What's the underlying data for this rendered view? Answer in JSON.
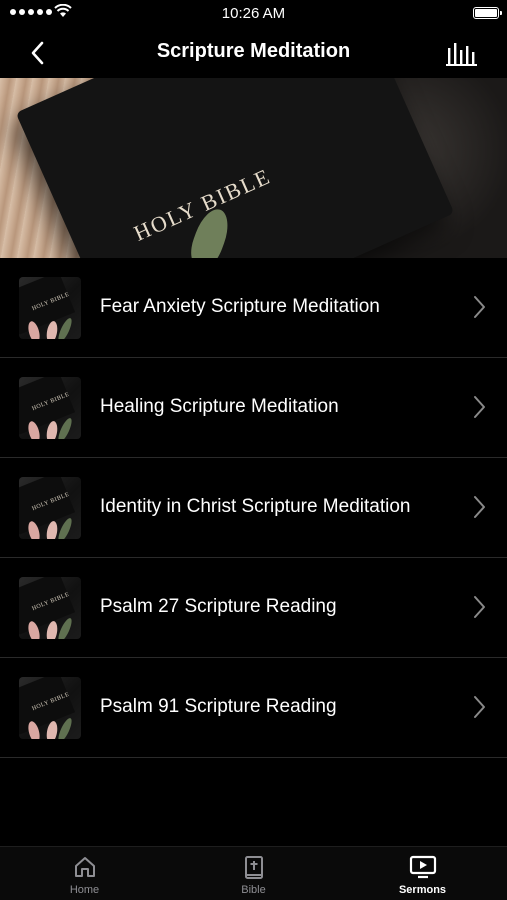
{
  "status_bar": {
    "time": "10:26 AM",
    "battery_level": 1.0
  },
  "nav": {
    "title": "Scripture Meditation",
    "back_icon": "chevron-left-icon",
    "right_icon": "audio-bars-icon"
  },
  "hero": {
    "book_text": "HOLY BIBLE"
  },
  "items": [
    {
      "title": "Fear Anxiety Scripture Meditation",
      "thumb_text": "HOLY BIBLE"
    },
    {
      "title": "Healing Scripture Meditation",
      "thumb_text": "HOLY BIBLE"
    },
    {
      "title": "Identity in Christ Scripture Meditation",
      "thumb_text": "HOLY BIBLE"
    },
    {
      "title": "Psalm 27 Scripture Reading",
      "thumb_text": "HOLY BIBLE"
    },
    {
      "title": "Psalm 91 Scripture Reading",
      "thumb_text": "HOLY BIBLE"
    }
  ],
  "tabs": [
    {
      "label": "Home",
      "icon": "home-icon",
      "active": false
    },
    {
      "label": "Bible",
      "icon": "bible-icon",
      "active": false
    },
    {
      "label": "Sermons",
      "icon": "tv-play-icon",
      "active": true
    }
  ],
  "colors": {
    "background": "#000000",
    "text": "#ffffff",
    "inactive_tab": "#8e8e93",
    "divider": "#2a2a2a"
  }
}
